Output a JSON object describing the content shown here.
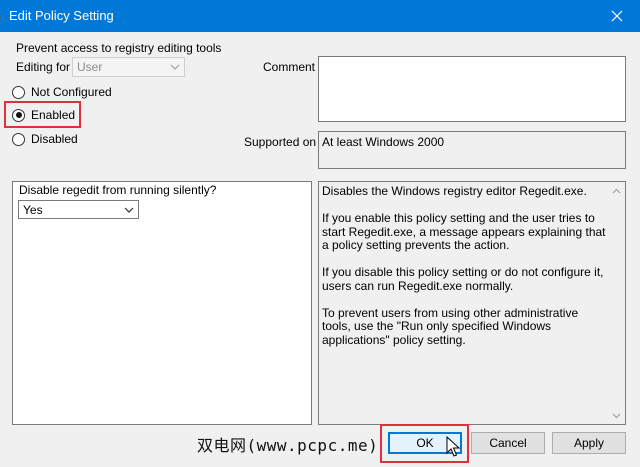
{
  "window": {
    "title": "Edit Policy Setting"
  },
  "policy": {
    "name": "Prevent access to registry editing tools",
    "editing_for_label": "Editing for",
    "editing_for_value": "User"
  },
  "radios": {
    "not_configured": "Not Configured",
    "enabled": "Enabled",
    "disabled": "Disabled",
    "selected": "enabled"
  },
  "comment": {
    "label": "Comment",
    "value": ""
  },
  "supported": {
    "label": "Supported on",
    "value": "At least Windows 2000"
  },
  "options": {
    "label": "Disable regedit from running silently?",
    "value": "Yes"
  },
  "help": {
    "paragraphs": [
      "Disables the Windows registry editor Regedit.exe.",
      "If you enable this policy setting and the user tries to start Regedit.exe, a message appears explaining that a policy setting prevents the action.",
      "If you disable this policy setting or do not configure it, users can run Regedit.exe normally.",
      "To prevent users from using other administrative tools, use the \"Run only specified Windows applications\" policy setting."
    ]
  },
  "watermark": "双电网(www.pcpc.me)",
  "buttons": {
    "ok": "OK",
    "cancel": "Cancel",
    "apply": "Apply"
  },
  "colors": {
    "titlebar": "#0078d7",
    "highlight": "#e0303b"
  }
}
